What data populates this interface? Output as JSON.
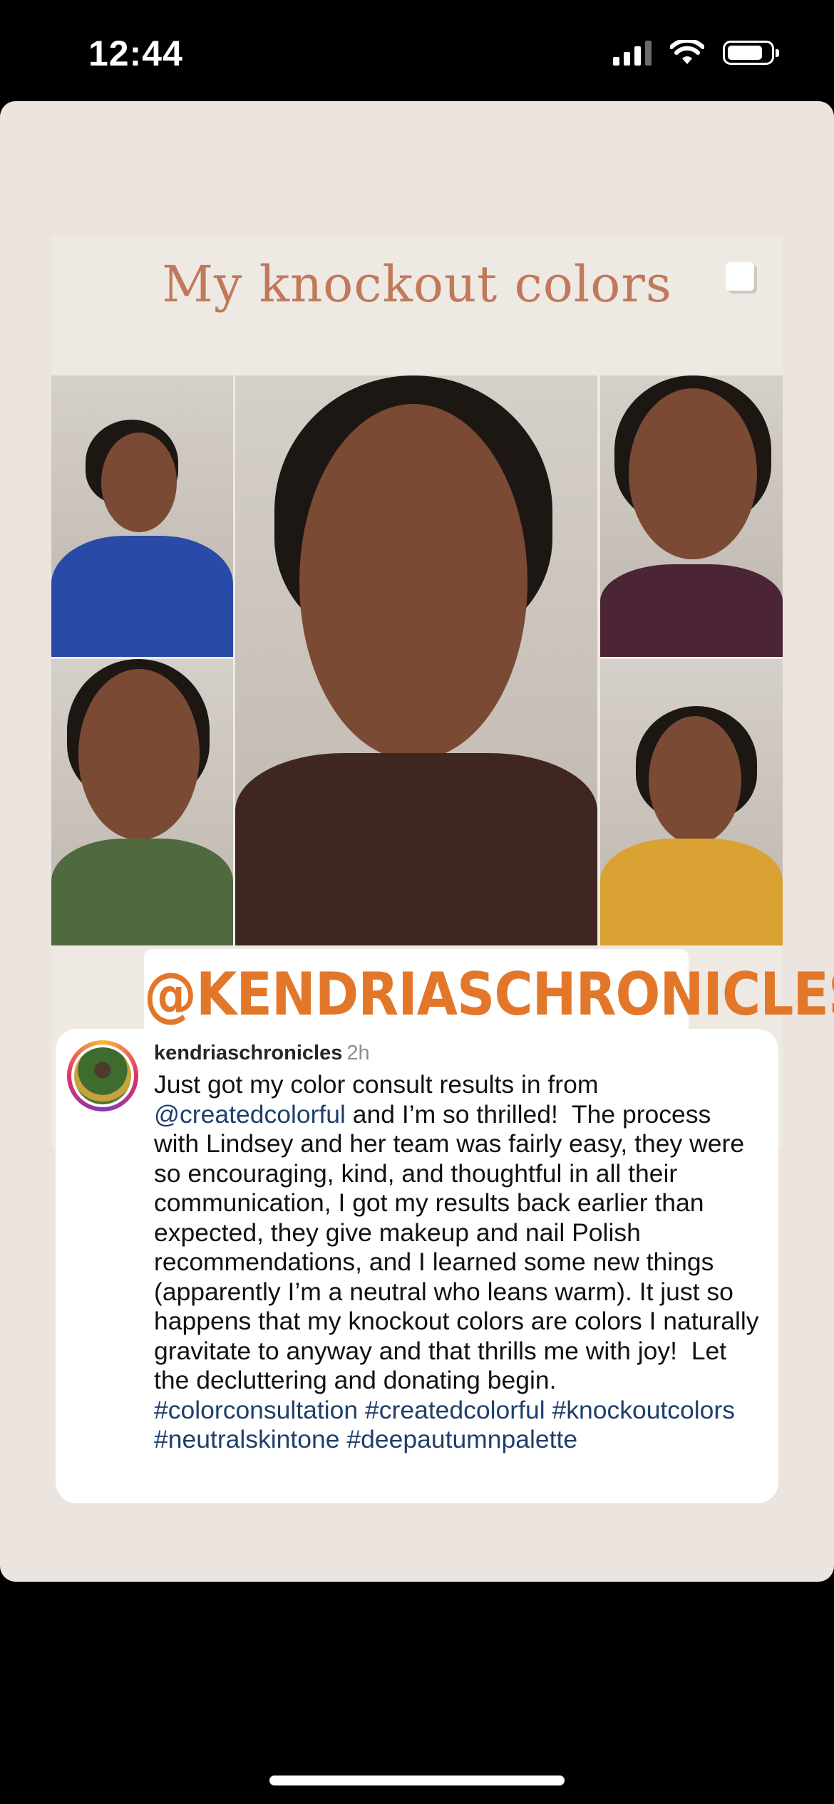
{
  "status_bar": {
    "time": "12:44",
    "icons": [
      "cellular-signal-icon",
      "wifi-icon",
      "battery-icon"
    ]
  },
  "story": {
    "post_title": "My knockout colors",
    "photo_colors": {
      "top_left": "#2a4aa8",
      "center": "#3f2621",
      "top_right": "#4b2536",
      "bottom_left": "#4f6a3f",
      "bottom_right": "#d9a233"
    },
    "handle_sticker": "@KENDRIASCHRONICLES",
    "handle_color": "#e2772a"
  },
  "caption": {
    "username": "kendriaschronicles",
    "time_ago": "2h",
    "text_part1": "Just got my color consult results in from ",
    "mention": "@createdcolorful",
    "text_part2": " and I’m so thrilled!  The process with Lindsey and her team was fairly easy, they were so encouraging, kind, and thoughtful in all their communication, I got my results back earlier than expected, they give makeup and nail Polish recommendations, and I learned some new things (apparently I’m a neutral who leans warm). It just so happens that my knockout colors are colors I naturally gravitate to anyway and that thrills me with joy!  Let the decluttering and donating begin. ",
    "hashtags": "#colorconsultation #createdcolorful #knockoutcolors #neutralskintone #deepautumnpalette"
  }
}
